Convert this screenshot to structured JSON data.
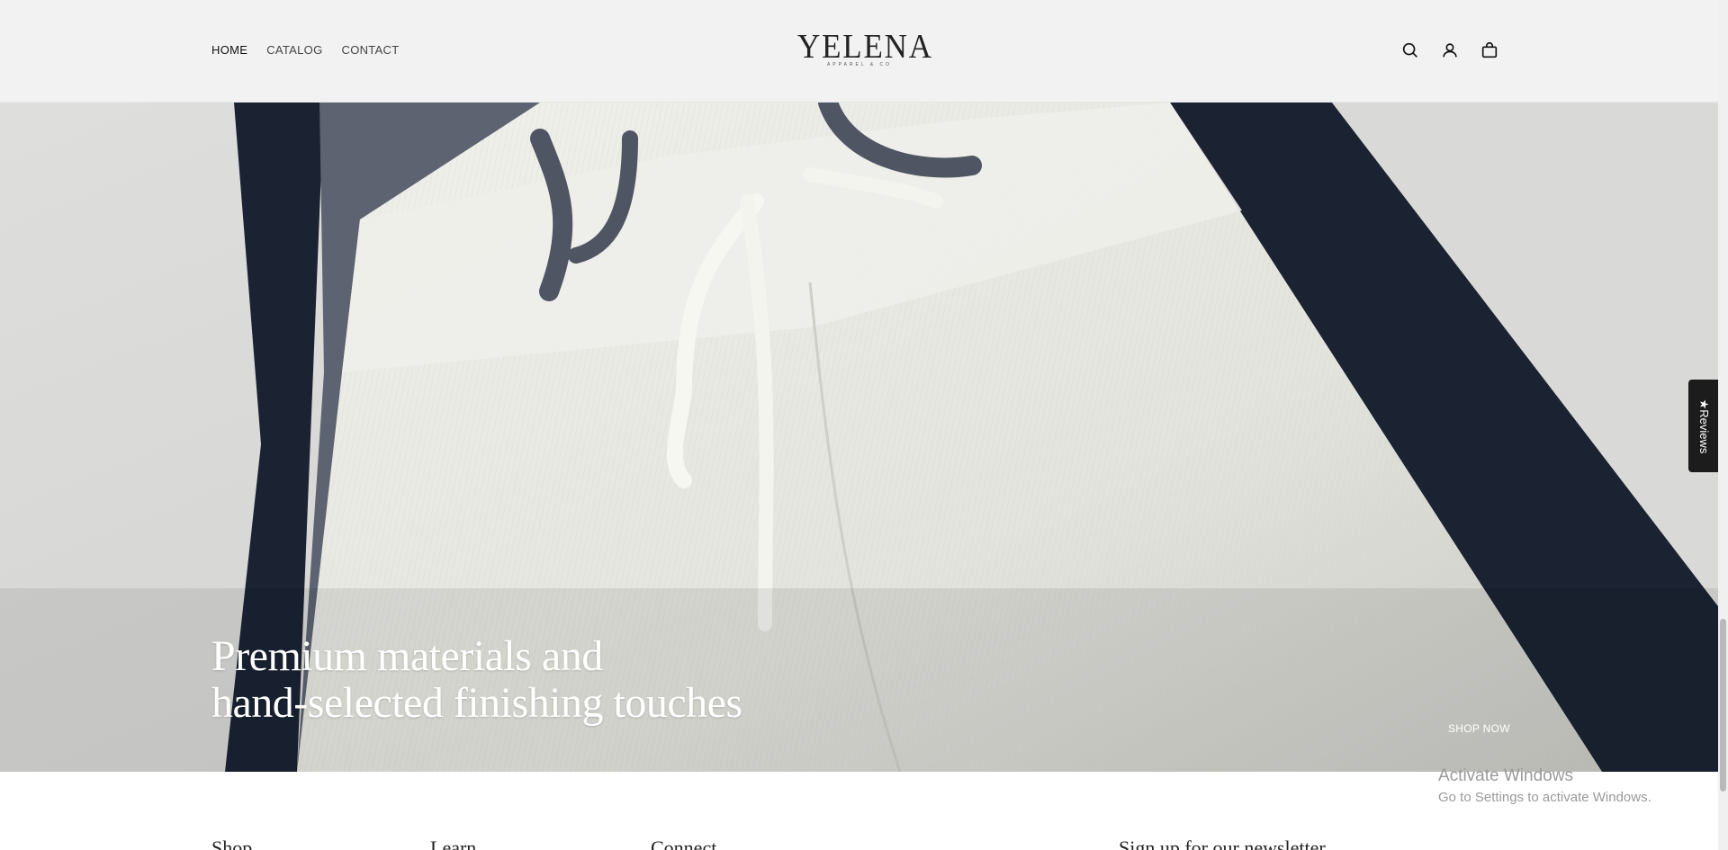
{
  "header": {
    "nav": [
      {
        "label": "HOME",
        "active": true
      },
      {
        "label": "CATALOG",
        "active": false
      },
      {
        "label": "CONTACT",
        "active": false
      }
    ],
    "logo": {
      "main": "YELENA",
      "sub": "APPAREL & CO"
    },
    "icons": [
      "search-icon",
      "account-icon",
      "cart-icon"
    ]
  },
  "hero": {
    "title_line1": "Premium materials and",
    "title_line2": "hand-selected finishing touches",
    "cta_label": "SHOP NOW"
  },
  "reviews_tab": {
    "label": "★Reviews"
  },
  "footer": {
    "columns": [
      "Shop",
      "Learn",
      "Connect",
      "Sign up for our newsletter"
    ]
  },
  "watermark": {
    "line1": "Activate Windows",
    "line2": "Go to Settings to activate Windows."
  },
  "colors": {
    "header_bg": "#f2f2f2",
    "hero_text": "#ffffff",
    "reviews_bg": "#1c1c1c"
  }
}
